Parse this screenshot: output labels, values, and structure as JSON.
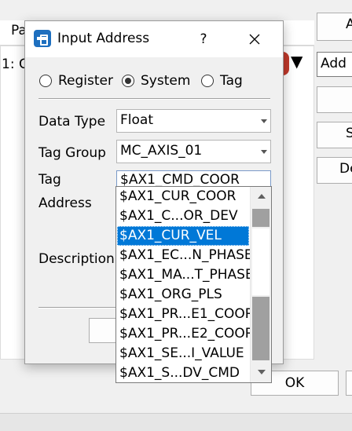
{
  "background": {
    "header_text": "Pa",
    "row_text": "1: C",
    "add_field_text": "Add",
    "buttons": [
      "A",
      "",
      "S",
      "De"
    ],
    "ok_label": "OK"
  },
  "dialog": {
    "title": "Input Address",
    "help_label": "?",
    "radios": [
      {
        "label": "Register",
        "selected": false
      },
      {
        "label": "System",
        "selected": true
      },
      {
        "label": "Tag",
        "selected": false
      }
    ],
    "data_type_label": "Data Type",
    "data_type_value": "Float",
    "tag_group_label": "Tag Group",
    "tag_group_value": "MC_AXIS_01",
    "tag_label": "Tag",
    "tag_value": "$AX1_CMD_COOR",
    "address_label": "Address",
    "description_label": "Description"
  },
  "dropdown": {
    "items": [
      "$AX1_CUR_COOR",
      "$AX1_C...OR_DEV",
      "$AX1_CUR_VEL",
      "$AX1_EC...N_PHASE",
      "$AX1_MA...T_PHASE",
      "$AX1_ORG_PLS",
      "$AX1_PR...E1_COOR",
      "$AX1_PR...E2_COOR",
      "$AX1_SE...I_VALUE",
      "$AX1_S...DV_CMD"
    ],
    "selected_index": 2
  },
  "colors": {
    "selection": "#0078d7",
    "app_icon": "#1e6fbf",
    "status_red": "#c0392b"
  }
}
